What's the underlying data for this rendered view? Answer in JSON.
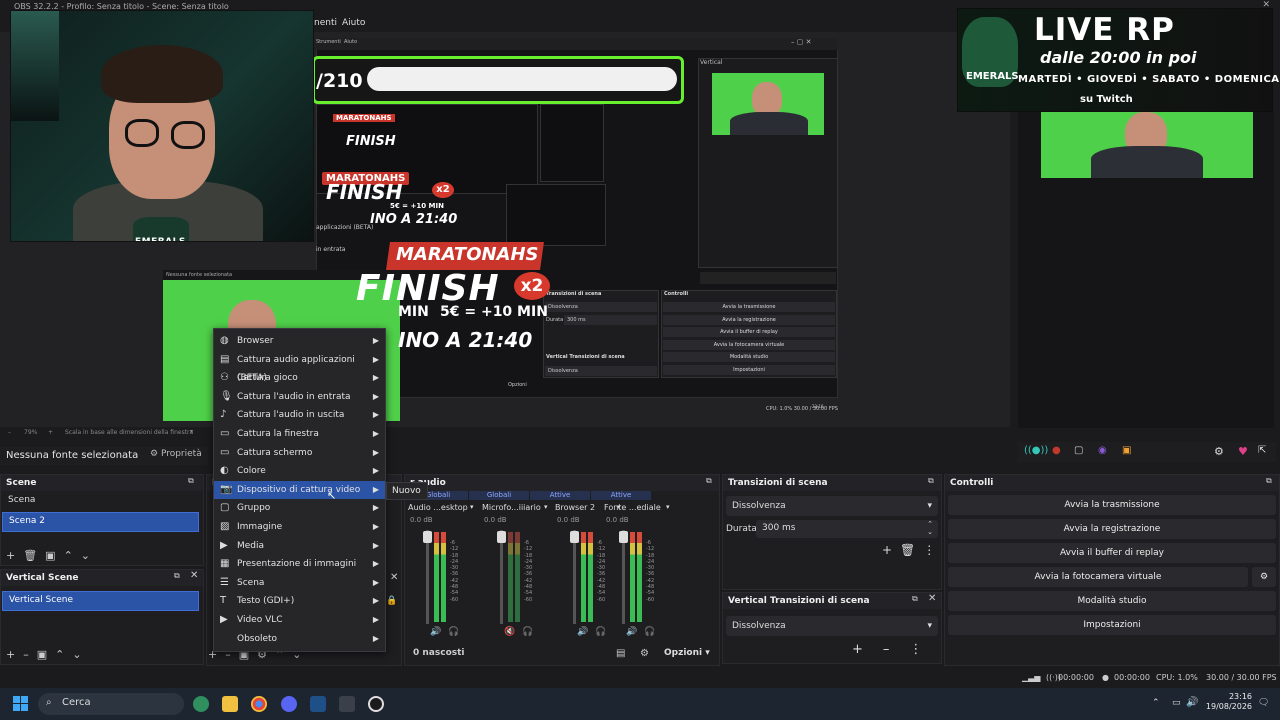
{
  "window": {
    "title": "OBS 32.2.2 - Profilo: Senza titolo - Scene: Senza titolo"
  },
  "menu": {
    "item_partial": "nenti",
    "help": "Aiuto"
  },
  "preview": {
    "counter": "/210",
    "promo": {
      "line1": "LIVE RP",
      "line2": "dalle 20:00 in poi",
      "days": "MARTEDÌ • GIOVEDÌ • SABATO • DOMENICA",
      "twitch": "su Twitch",
      "brand": "EMERALS"
    },
    "finish_title": "MARATONAHS",
    "finish_big": "FINISH",
    "finish_x2": "x2",
    "finish_rule": "5€ = +10 MIN",
    "finish_min": "MIN",
    "finish_time": "INO A 21:40",
    "nested_menu": {
      "strumenti": "Strumenti",
      "aiuto": "Aiuto"
    },
    "nested_vertical": "Vertical",
    "nested_no_source": "Nessuna fonte selezionata",
    "nested_transitions": "Transizioni di scena",
    "nested_controls": "Controlli",
    "nested_dissolve": "Dissolvenza",
    "nested_duration": "Durata",
    "nested_ms": "300 ms",
    "nested_vertical_transitions": "Vertical Transizioni di scena",
    "nested_controls_buttons": [
      "Avvia la trasmissione",
      "Avvia la registrazione",
      "Avvia il buffer di replay",
      "Avvia la fotocamera virtuale",
      "Modalità studio",
      "Impostazioni"
    ],
    "nested_options": "Opzioni",
    "nested_applicazioni": "applicazioni (BETA)",
    "nested_entrata": "in entrata",
    "nested_fps": "CPU: 1.0%   30.00 / 30.00 FPS",
    "nested_clock": "23:16",
    "zoom": "79%",
    "scale_label": "Scala in base alle dimensioni della finestra"
  },
  "source_bar": {
    "no_source": "Nessuna fonte selezionata",
    "properties": "Proprietà"
  },
  "scenes": {
    "title": "Scene",
    "items": [
      "Scena",
      "Scena 2"
    ],
    "selected": "Scena 2"
  },
  "vertical_scenes": {
    "title": "Vertical Scene",
    "items": [
      "Vertical Scene"
    ]
  },
  "sources_dock": {
    "title": "F"
  },
  "context_menu": {
    "items": [
      {
        "label": "Browser",
        "icon": "globe-icon"
      },
      {
        "label": "Cattura audio applicazioni (BETA)",
        "icon": "app-audio-icon"
      },
      {
        "label": "Cattura gioco",
        "icon": "gamepad-icon"
      },
      {
        "label": "Cattura l'audio in entrata",
        "icon": "microphone-icon"
      },
      {
        "label": "Cattura l'audio in uscita",
        "icon": "speaker-icon"
      },
      {
        "label": "Cattura la finestra",
        "icon": "window-icon"
      },
      {
        "label": "Cattura schermo",
        "icon": "monitor-icon"
      },
      {
        "label": "Colore",
        "icon": "palette-icon"
      },
      {
        "label": "Dispositivo di cattura video",
        "icon": "camera-icon"
      },
      {
        "label": "Gruppo",
        "icon": "folder-icon"
      },
      {
        "label": "Immagine",
        "icon": "image-icon"
      },
      {
        "label": "Media",
        "icon": "play-icon"
      },
      {
        "label": "Presentazione di immagini",
        "icon": "slideshow-icon"
      },
      {
        "label": "Scena",
        "icon": "list-icon"
      },
      {
        "label": "Testo (GDI+)",
        "icon": "text-icon"
      },
      {
        "label": "Video VLC",
        "icon": "play-icon"
      },
      {
        "label": "Obsoleto",
        "icon": ""
      }
    ],
    "highlighted": "Dispositivo di cattura video",
    "submenu": "Nuovo"
  },
  "mixer": {
    "title": "r audio",
    "top_labels": [
      "Globali",
      "Globali",
      "Attive",
      "Attive"
    ],
    "channels": [
      {
        "name": "Audio ...esktop",
        "db": "0.0 dB"
      },
      {
        "name": "Microfo...iiiario",
        "db": "0.0 dB"
      },
      {
        "name": "Browser 2",
        "db": "0.0 dB"
      },
      {
        "name": "Fonte ...ediale",
        "db": "0.0 dB"
      }
    ],
    "ticks": [
      "-6",
      "-12",
      "-18",
      "-24",
      "-30",
      "-36",
      "-42",
      "-48",
      "-54",
      "-60"
    ],
    "hidden": "0 nascosti",
    "options": "Opzioni"
  },
  "transitions": {
    "title": "Transizioni di scena",
    "type": "Dissolvenza",
    "duration_label": "Durata",
    "duration": "300 ms",
    "vertical_title": "Vertical Transizioni di scena",
    "vertical_type": "Dissolvenza"
  },
  "controls": {
    "title": "Controlli",
    "buttons": [
      "Avvia la trasmissione",
      "Avvia la registrazione",
      "Avvia il buffer di replay",
      "Avvia la fotocamera virtuale",
      "Modalità studio",
      "Impostazioni"
    ]
  },
  "status": {
    "rec_time1": "00:00:00",
    "rec_time2": "00:00:00",
    "cpu": "CPU: 1.0%",
    "fps": "30.00 / 30.00 FPS"
  },
  "taskbar": {
    "search": "Cerca",
    "time": "23:16",
    "date": "19/08/2026"
  },
  "colors": {
    "accent": "#2b53a6",
    "green_border": "#67ef2f",
    "meter_green": "#3bbd56"
  }
}
